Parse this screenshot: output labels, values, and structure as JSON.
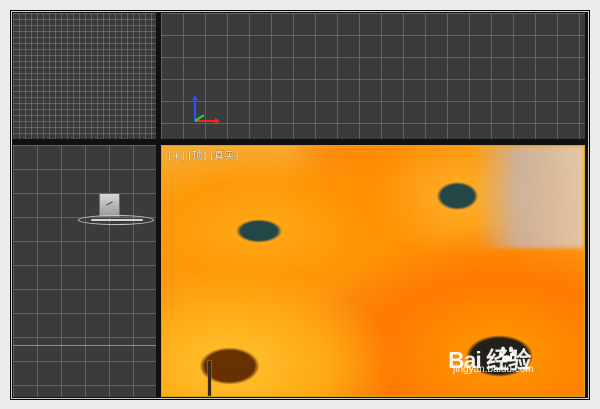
{
  "screen": {
    "viewports": {
      "top_label": "",
      "front_label": "",
      "left_label": "",
      "perspective_label": "[+] [顶] [真实]"
    },
    "colors": {
      "frame": "#101010",
      "viewport_background": "#3b3b3b",
      "active_viewport_border": "#d8a51d"
    },
    "icons": {
      "axis": "axis-gizmo-icon",
      "view_cube": "view-cube-icon",
      "watermark_logo": "baidu-paw-icon"
    },
    "watermark": {
      "brand": "Bai 经验",
      "site": "jingyan.baidu.com"
    }
  }
}
